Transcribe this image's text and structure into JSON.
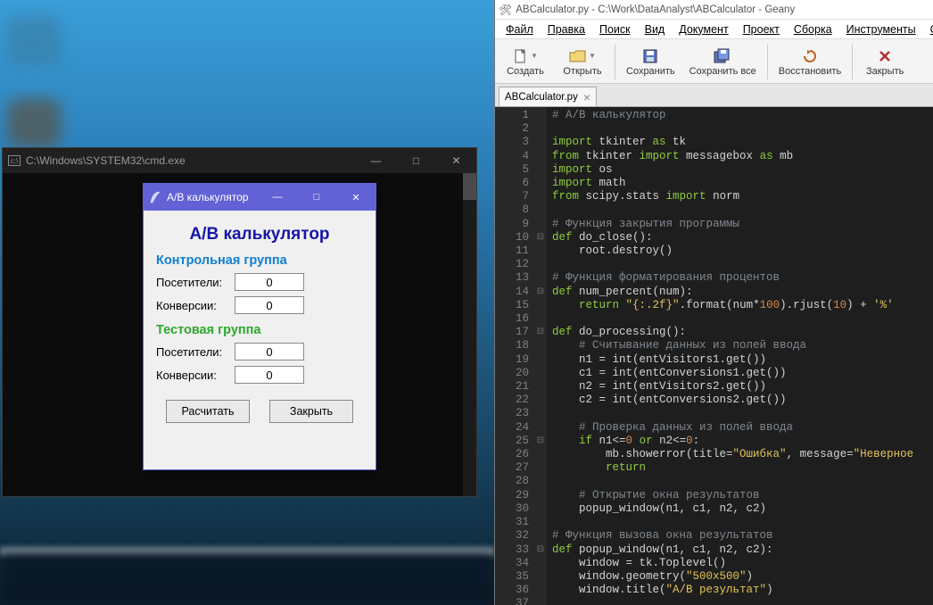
{
  "cmd": {
    "title": "C:\\Windows\\SYSTEM32\\cmd.exe",
    "min": "—",
    "max": "□",
    "close": "✕"
  },
  "tk": {
    "title": "A/B калькулятор",
    "heading": "A/B калькулятор",
    "section_control": "Контрольная группа",
    "section_test": "Тестовая группа",
    "label_visitors": "Посетители:",
    "label_conversions": "Конверсии:",
    "val_visitors1": "0",
    "val_conversions1": "0",
    "val_visitors2": "0",
    "val_conversions2": "0",
    "btn_calc": "Расчитать",
    "btn_close": "Закрыть",
    "min": "—",
    "max": "□",
    "close": "✕"
  },
  "geany": {
    "window_title": "ABCalculator.py - C:\\Work\\DataAnalyst\\ABCalculator - Geany",
    "menu": [
      "Файл",
      "Правка",
      "Поиск",
      "Вид",
      "Документ",
      "Проект",
      "Сборка",
      "Инструменты",
      "Справка"
    ],
    "toolbar": {
      "new": "Создать",
      "open": "Открыть",
      "save": "Сохранить",
      "saveall": "Сохранить все",
      "revert": "Восстановить",
      "close": "Закрыть"
    },
    "tab": "ABCalculator.py",
    "code": [
      {
        "n": 1,
        "f": "",
        "t": "# A/B калькулятор",
        "c": [
          "cm"
        ]
      },
      {
        "n": 2,
        "f": "",
        "t": "",
        "c": []
      },
      {
        "n": 3,
        "f": "",
        "h": "<span class='kw'>import</span> tkinter <span class='kw'>as</span> tk"
      },
      {
        "n": 4,
        "f": "",
        "h": "<span class='kw'>from</span> tkinter <span class='kw'>import</span> messagebox <span class='kw'>as</span> mb"
      },
      {
        "n": 5,
        "f": "",
        "h": "<span class='kw'>import</span> os"
      },
      {
        "n": 6,
        "f": "",
        "h": "<span class='kw'>import</span> math"
      },
      {
        "n": 7,
        "f": "",
        "h": "<span class='kw'>from</span> scipy.stats <span class='kw'>import</span> norm"
      },
      {
        "n": 8,
        "f": "",
        "t": "",
        "c": []
      },
      {
        "n": 9,
        "f": "",
        "t": "# Функция закрытия программы",
        "c": [
          "cm"
        ]
      },
      {
        "n": 10,
        "f": "⊟",
        "h": "<span class='kw'>def</span> do_close():"
      },
      {
        "n": 11,
        "f": "",
        "h": "    root.destroy()"
      },
      {
        "n": 12,
        "f": "",
        "t": "",
        "c": []
      },
      {
        "n": 13,
        "f": "",
        "t": "# Функция форматирования процентов",
        "c": [
          "cm"
        ]
      },
      {
        "n": 14,
        "f": "⊟",
        "h": "<span class='kw'>def</span> num_percent(num):"
      },
      {
        "n": 15,
        "f": "",
        "h": "    <span class='kw'>return</span> <span class='str'>\"{:.2f}\"</span>.format(num*<span class='num'>100</span>).rjust(<span class='num'>10</span>) + <span class='str'>'%'</span>"
      },
      {
        "n": 16,
        "f": "",
        "t": "",
        "c": []
      },
      {
        "n": 17,
        "f": "⊟",
        "h": "<span class='kw'>def</span> do_processing():"
      },
      {
        "n": 18,
        "f": "",
        "t": "    # Считывание данных из полей ввода",
        "c": [
          "cm"
        ]
      },
      {
        "n": 19,
        "f": "",
        "h": "    n1 = int(entVisitors1.get())"
      },
      {
        "n": 20,
        "f": "",
        "h": "    c1 = int(entConversions1.get())"
      },
      {
        "n": 21,
        "f": "",
        "h": "    n2 = int(entVisitors2.get())"
      },
      {
        "n": 22,
        "f": "",
        "h": "    c2 = int(entConversions2.get())"
      },
      {
        "n": 23,
        "f": "",
        "t": "",
        "c": []
      },
      {
        "n": 24,
        "f": "",
        "t": "    # Проверка данных из полей ввода",
        "c": [
          "cm"
        ]
      },
      {
        "n": 25,
        "f": "⊟",
        "h": "    <span class='kw'>if</span> n1&lt;=<span class='num'>0</span> <span class='kw'>or</span> n2&lt;=<span class='num'>0</span>:"
      },
      {
        "n": 26,
        "f": "",
        "h": "        mb.showerror(title=<span class='str'>\"Ошибка\"</span>, message=<span class='str'>\"Неверное</span>"
      },
      {
        "n": 27,
        "f": "",
        "h": "        <span class='kw'>return</span>"
      },
      {
        "n": 28,
        "f": "",
        "t": "",
        "c": []
      },
      {
        "n": 29,
        "f": "",
        "t": "    # Открытие окна результатов",
        "c": [
          "cm"
        ]
      },
      {
        "n": 30,
        "f": "",
        "h": "    popup_window(n1, c1, n2, c2)"
      },
      {
        "n": 31,
        "f": "",
        "t": "",
        "c": []
      },
      {
        "n": 32,
        "f": "",
        "t": "# Функция вызова окна результатов",
        "c": [
          "cm"
        ]
      },
      {
        "n": 33,
        "f": "⊟",
        "h": "<span class='kw'>def</span> popup_window(n1, c1, n2, c2):"
      },
      {
        "n": 34,
        "f": "",
        "h": "    window = tk.Toplevel()"
      },
      {
        "n": 35,
        "f": "",
        "h": "    window.geometry(<span class='str'>\"500x500\"</span>)"
      },
      {
        "n": 36,
        "f": "",
        "h": "    window.title(<span class='str'>\"A/B результат\"</span>)"
      },
      {
        "n": 37,
        "f": "",
        "t": "",
        "c": []
      }
    ]
  }
}
